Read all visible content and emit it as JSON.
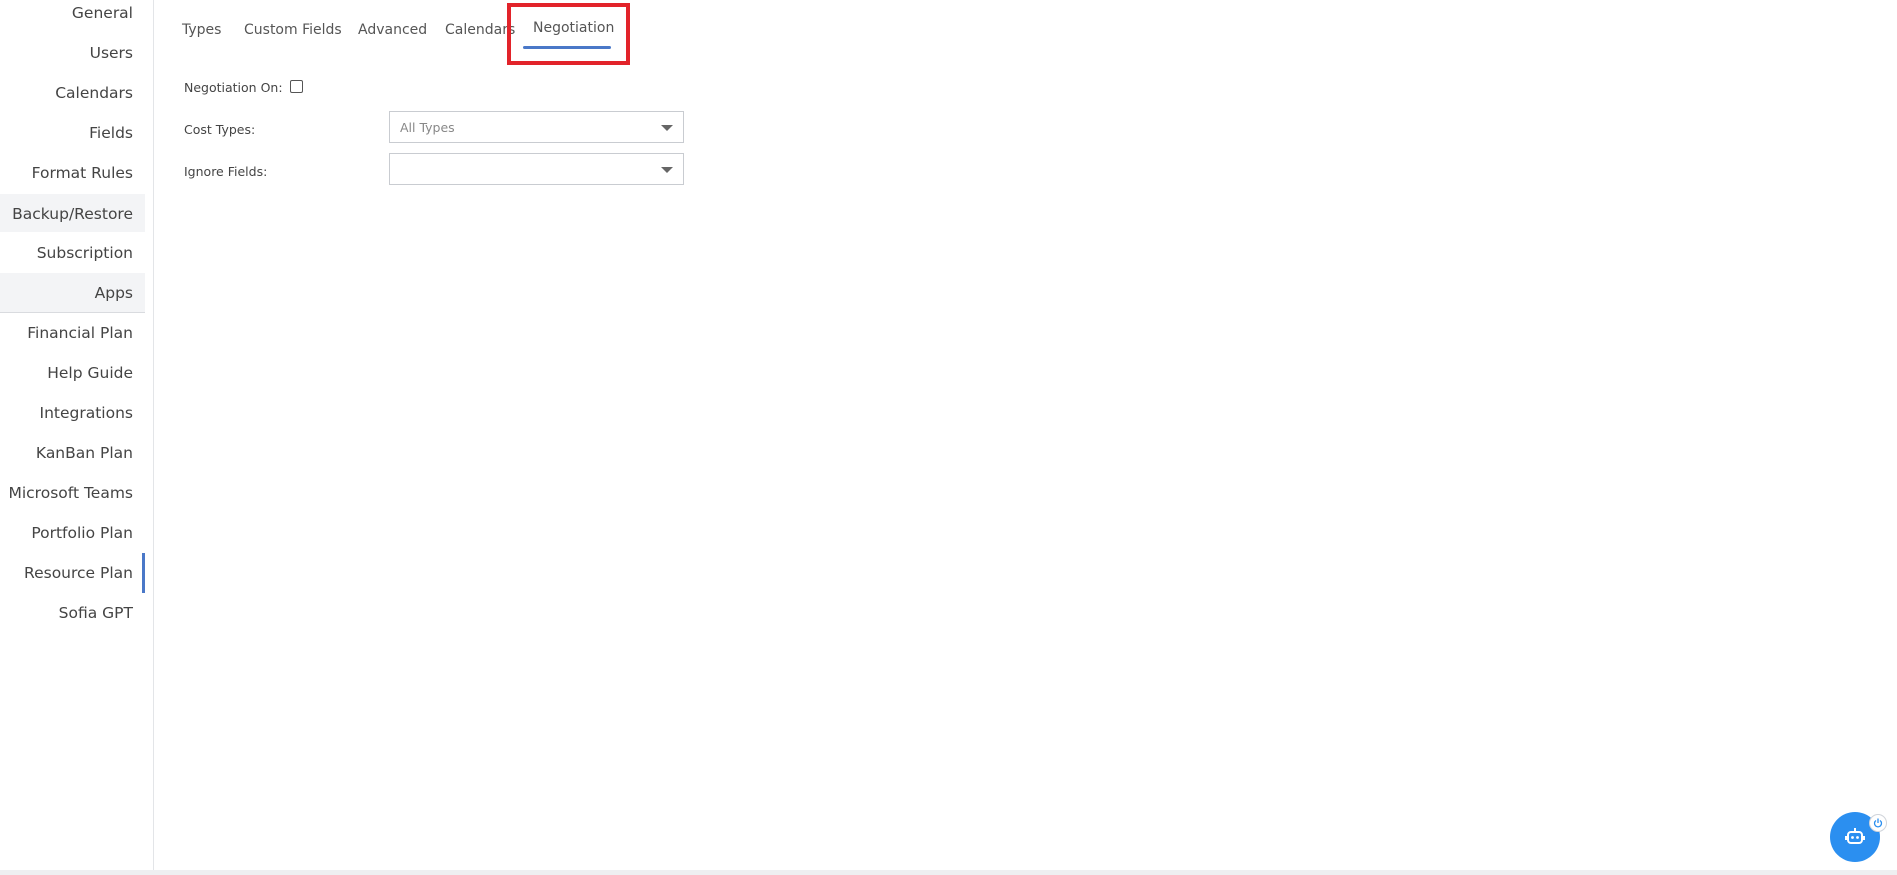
{
  "sidebar": {
    "items": [
      {
        "label": "General"
      },
      {
        "label": "Users"
      },
      {
        "label": "Calendars"
      },
      {
        "label": "Fields"
      },
      {
        "label": "Format Rules"
      },
      {
        "label": "Backup/Restore"
      },
      {
        "label": "Subscription"
      },
      {
        "label": "Apps"
      },
      {
        "label": "Financial Plan"
      },
      {
        "label": "Help Guide"
      },
      {
        "label": "Integrations"
      },
      {
        "label": "KanBan Plan"
      },
      {
        "label": "Microsoft Teams"
      },
      {
        "label": "Portfolio Plan"
      },
      {
        "label": "Resource Plan"
      },
      {
        "label": "Sofia GPT"
      }
    ]
  },
  "tabs": {
    "items": [
      {
        "label": "Types"
      },
      {
        "label": "Custom Fields"
      },
      {
        "label": "Advanced"
      },
      {
        "label": "Calendars"
      },
      {
        "label": "Negotiation"
      }
    ],
    "active": "Negotiation"
  },
  "form": {
    "negotiation_on_label": "Negotiation On:",
    "negotiation_on_checked": false,
    "cost_types_label": "Cost Types:",
    "cost_types_value": "All Types",
    "ignore_fields_label": "Ignore Fields:",
    "ignore_fields_value": ""
  },
  "colors": {
    "accent": "#4a78c8",
    "highlight": "#e2232a",
    "chat_button": "#2b8ff0"
  },
  "icons": {
    "chat": "bot-icon",
    "power": "power-icon",
    "dropdown": "chevron-down-icon"
  }
}
